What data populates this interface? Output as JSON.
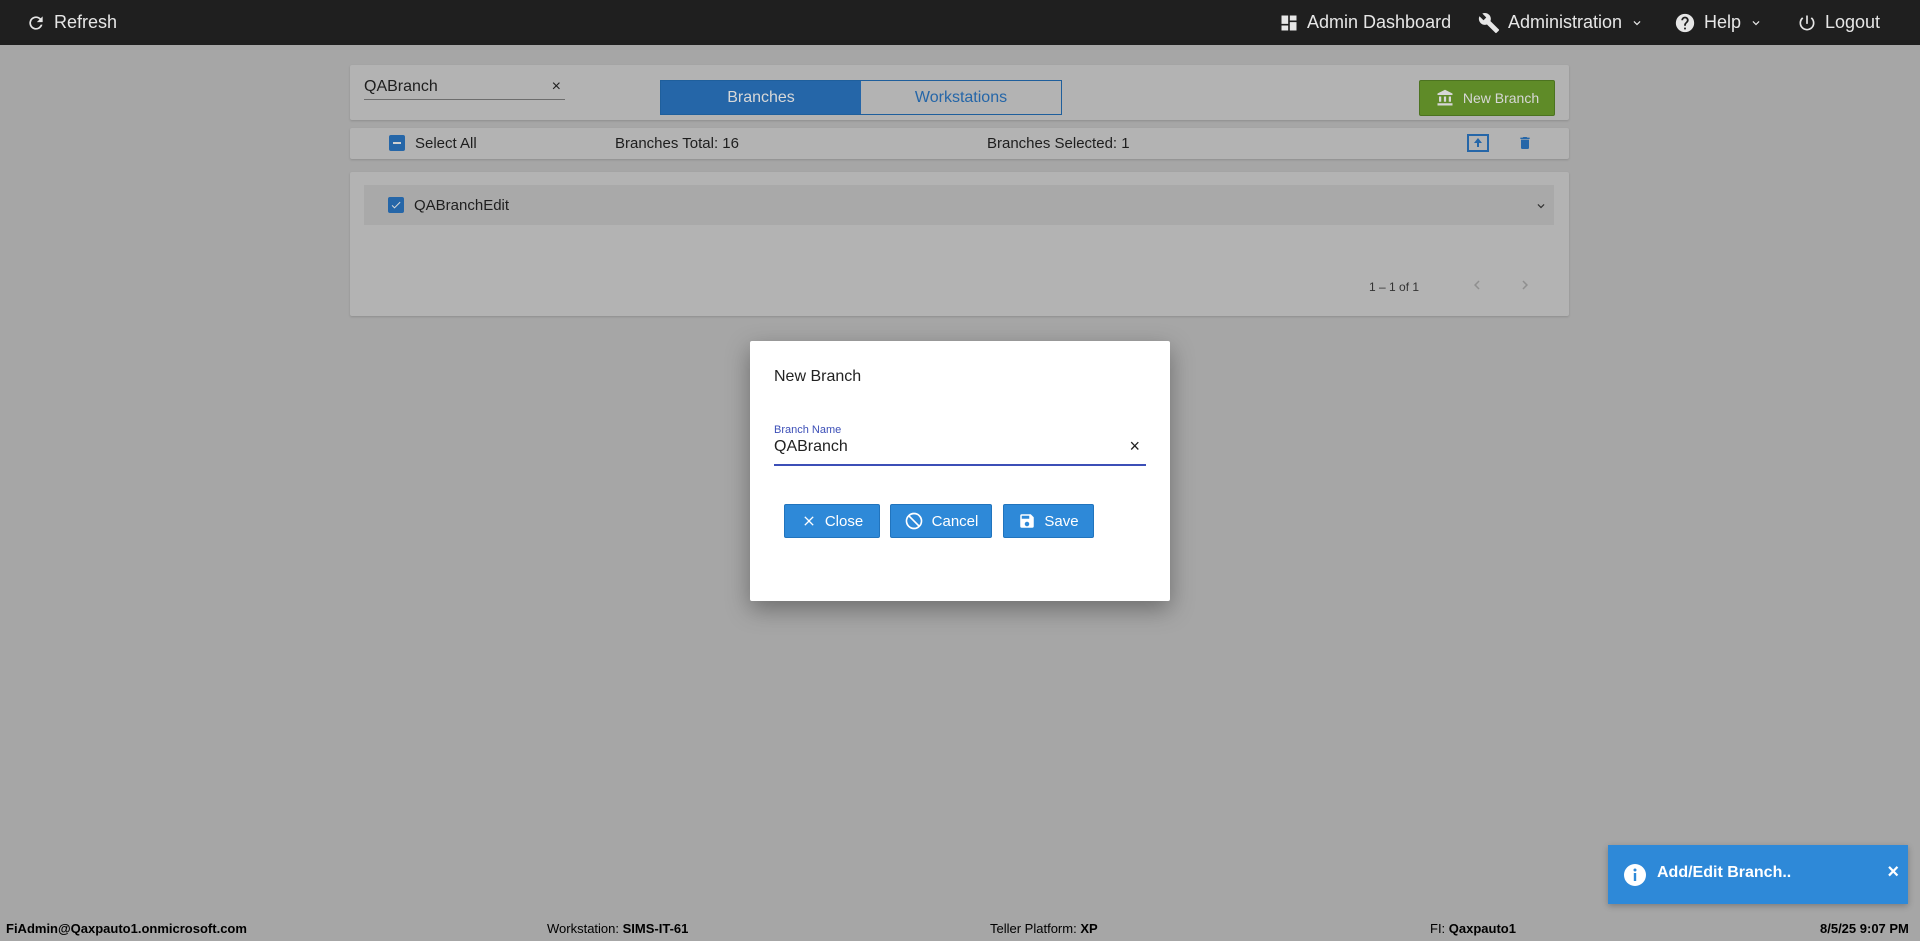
{
  "topbar": {
    "refresh": "Refresh",
    "admin_dashboard": "Admin Dashboard",
    "administration": "Administration",
    "help": "Help",
    "logout": "Logout"
  },
  "toolbar": {
    "search_value": "QABranch",
    "search_clear": "×",
    "tabs": [
      "Branches",
      "Workstations"
    ],
    "new_branch": "New Branch"
  },
  "actions_bar": {
    "select_all": "Select All",
    "branches_total": "Branches Total: 16",
    "branches_selected": "Branches Selected: 1"
  },
  "list": {
    "rows": [
      {
        "label": "QABranchEdit"
      }
    ],
    "pager": "1 – 1 of 1"
  },
  "modal": {
    "title": "New Branch",
    "field_label": "Branch Name",
    "field_value": "QABranch",
    "field_clear": "×",
    "close": "Close",
    "cancel": "Cancel",
    "save": "Save"
  },
  "toast": {
    "message": "Add/Edit Branch..",
    "close": "×"
  },
  "status": {
    "user": "FiAdmin@Qaxpauto1.onmicrosoft.com",
    "workstation_label": "Workstation:",
    "workstation": "SIMS-IT-61",
    "platform_label": "Teller Platform:",
    "platform": "XP",
    "fi_label": "FI:",
    "fi": "Qaxpauto1",
    "datetime": "8/5/25 9:07 PM"
  },
  "colors": {
    "primary": "#2e89d8",
    "success": "#6fa12b",
    "topbar": "#1f1f1f"
  }
}
